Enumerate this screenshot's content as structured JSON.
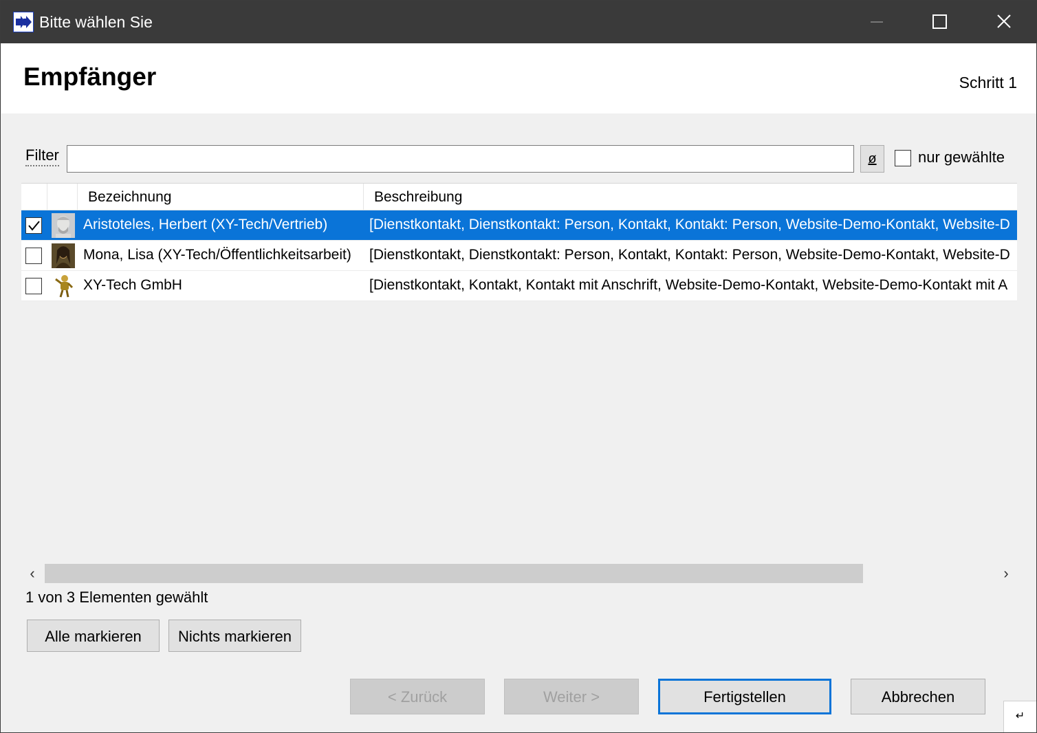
{
  "window": {
    "title": "Bitte wählen Sie"
  },
  "header": {
    "title": "Empfänger",
    "step": "Schritt 1"
  },
  "filter": {
    "label": "Filter",
    "value": "",
    "clear_label": "ø",
    "only_selected_label": "nur gewählte",
    "only_selected_checked": false
  },
  "grid": {
    "columns": [
      "Bezeichnung",
      "Beschreibung"
    ],
    "rows": [
      {
        "checked": true,
        "selected": true,
        "avatar": "bust-icon",
        "name": "Aristoteles, Herbert (XY-Tech/Vertrieb)",
        "description": "[Dienstkontakt, Dienstkontakt: Person, Kontakt, Kontakt: Person, Website-Demo-Kontakt, Website-D"
      },
      {
        "checked": false,
        "selected": false,
        "avatar": "portrait-icon",
        "name": "Mona, Lisa (XY-Tech/Öffentlichkeitsarbeit)",
        "description": "[Dienstkontakt, Dienstkontakt: Person, Kontakt, Kontakt: Person, Website-Demo-Kontakt, Website-D"
      },
      {
        "checked": false,
        "selected": false,
        "avatar": "figure-icon",
        "name": "XY-Tech GmbH",
        "description": "[Dienstkontakt, Kontakt, Kontakt mit Anschrift, Website-Demo-Kontakt, Website-Demo-Kontakt mit A"
      }
    ]
  },
  "scroll": {
    "position": 0.0
  },
  "status": "1 von 3 Elementen gewählt",
  "buttons": {
    "select_all": "Alle markieren",
    "select_none": "Nichts markieren",
    "back": "< Zurück",
    "next": "Weiter >",
    "finish": "Fertigstellen",
    "cancel": "Abbrechen"
  },
  "colors": {
    "selection": "#0a74d8",
    "titlebar": "#3a3a3a"
  }
}
